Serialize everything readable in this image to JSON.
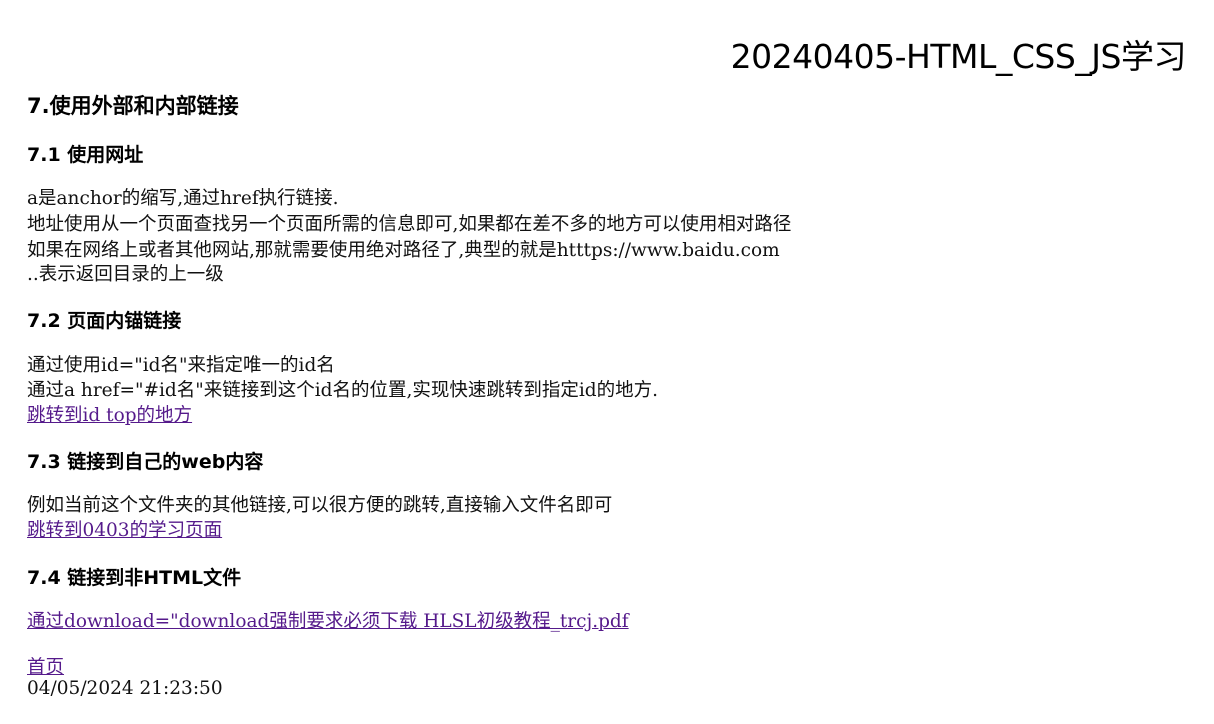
{
  "page_title": "20240405-HTML_CSS_JS学习",
  "section7": {
    "heading": "7.使用外部和内部链接"
  },
  "sub71": {
    "heading": "7.1 使用网址",
    "lines": [
      "a是anchor的缩写,通过href执行链接.",
      "地址使用从一个页面查找另一个页面所需的信息即可,如果都在差不多的地方可以使用相对路径",
      "如果在网络上或者其他网站,那就需要使用绝对路径了,典型的就是htttps://www.baidu.com",
      "..表示返回目录的上一级"
    ]
  },
  "sub72": {
    "heading": "7.2 页面内锚链接",
    "lines": [
      "通过使用id=\"id名\"来指定唯一的id名",
      "通过a href=\"#id名\"来链接到这个id名的位置,实现快速跳转到指定id的地方."
    ],
    "link": "跳转到id top的地方"
  },
  "sub73": {
    "heading": "7.3 链接到自己的web内容",
    "line": "例如当前这个文件夹的其他链接,可以很方便的跳转,直接输入文件名即可",
    "link": "跳转到0403的学习页面"
  },
  "sub74": {
    "heading": "7.4 链接到非HTML文件",
    "link": "通过download=\"download强制要求必须下载 HLSL初级教程_trcj.pdf"
  },
  "footer": {
    "home_link": "首页",
    "timestamp": "04/05/2024 21:23:50"
  },
  "colors": {
    "link": "#551a8b",
    "text": "#111111",
    "background": "#ffffff"
  }
}
